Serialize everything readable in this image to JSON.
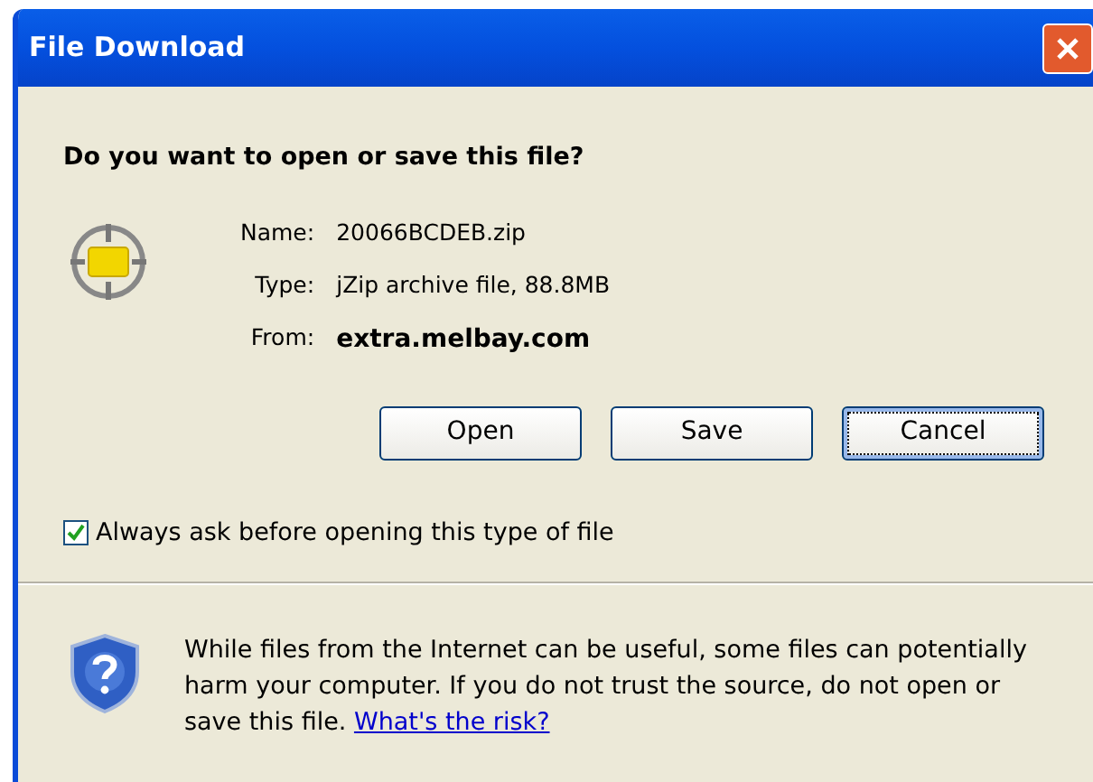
{
  "window": {
    "title": "File Download"
  },
  "question": "Do you want to open or save this file?",
  "details": [
    {
      "label": "Name:",
      "value": "20066BCDEB.zip",
      "emphasis": false
    },
    {
      "label": "Type:",
      "value": "jZip archive file, 88.8MB",
      "emphasis": false
    },
    {
      "label": "From:",
      "value": "extra.melbay.com",
      "emphasis": true
    }
  ],
  "buttons": [
    {
      "label": "Open",
      "focused": false
    },
    {
      "label": "Save",
      "focused": false
    },
    {
      "label": "Cancel",
      "focused": true
    }
  ],
  "always_ask": {
    "label": "Always ask before opening this type of file",
    "checked": true
  },
  "warning": {
    "text": "While files from the Internet can be useful, some files can potentially harm your computer. If you do not trust the source, do not open or save this file.",
    "link": "What's the risk?"
  }
}
